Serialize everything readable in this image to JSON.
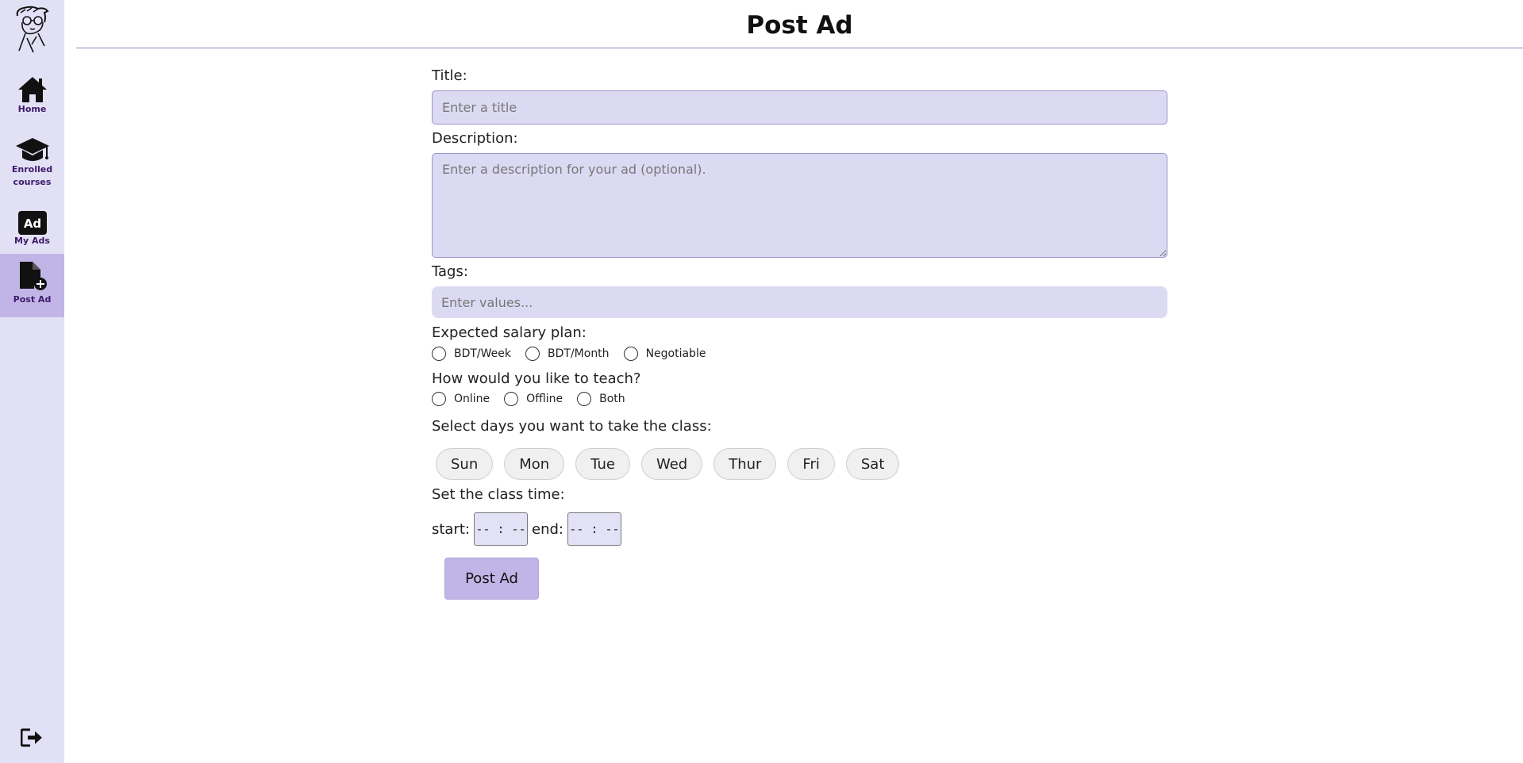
{
  "sidebar": {
    "items": [
      {
        "label": "Home",
        "icon": "home-icon"
      },
      {
        "label": "Enrolled courses",
        "icon": "graduation-cap-icon"
      },
      {
        "label": "My Ads",
        "icon": "ad-icon"
      },
      {
        "label": "Post Ad",
        "icon": "file-add-icon",
        "active": true
      }
    ],
    "logout_icon": "logout-icon",
    "active_color": "#c1b5e8",
    "background_color": "#e2e0f5"
  },
  "header": {
    "title": "Post Ad"
  },
  "form": {
    "title_label": "Title:",
    "title_placeholder": "Enter a title",
    "description_label": "Description:",
    "description_placeholder": "Enter a description for your ad (optional).",
    "tags_label": "Tags:",
    "tags_placeholder": "Enter values...",
    "salary_label": "Expected salary plan:",
    "salary_options": [
      "BDT/Week",
      "BDT/Month",
      "Negotiable"
    ],
    "teach_label": "How would you like to teach?",
    "teach_options": [
      "Online",
      "Offline",
      "Both"
    ],
    "days_label": "Select days you want to take the class:",
    "days": [
      "Sun",
      "Mon",
      "Tue",
      "Wed",
      "Thur",
      "Fri",
      "Sat"
    ],
    "time_label": "Set the class time:",
    "start_label": "start:",
    "start_value": "-- : --",
    "end_label": "end:",
    "end_value": "-- : --",
    "submit_label": "Post Ad"
  }
}
